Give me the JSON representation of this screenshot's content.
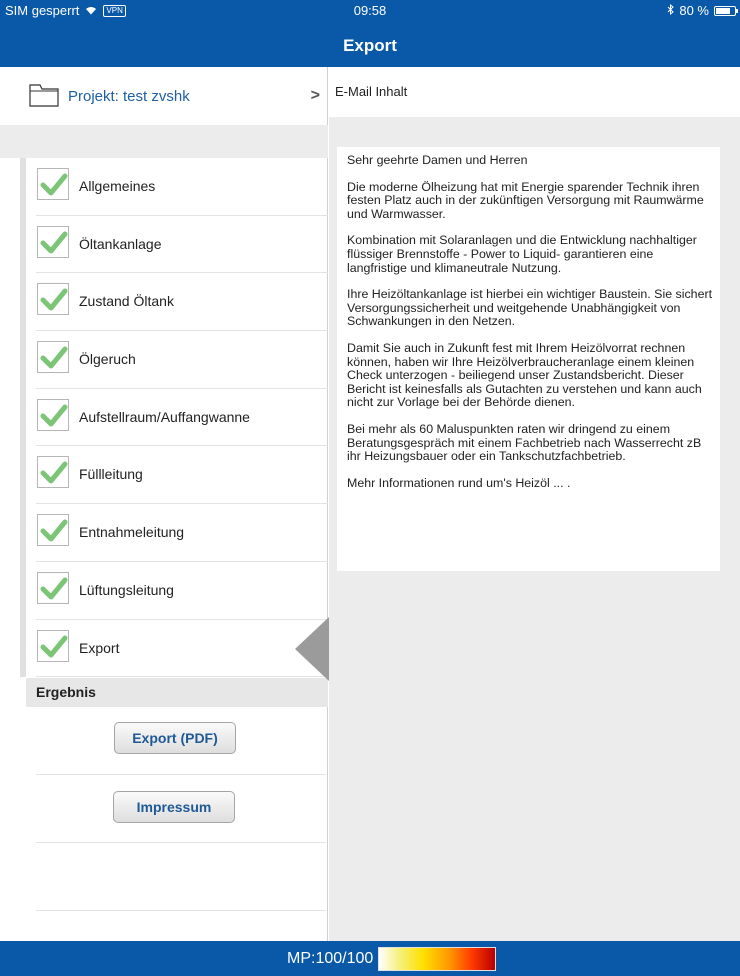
{
  "status_bar": {
    "carrier": "SIM gesperrt",
    "vpn": "VPN",
    "time": "09:58",
    "battery": "80 %"
  },
  "nav": {
    "title": "Export"
  },
  "project": {
    "label": "Projekt: test zvshk",
    "chevron": ">"
  },
  "sections": [
    {
      "label": "Allgemeines",
      "checked": true
    },
    {
      "label": "Öltankanlage",
      "checked": true
    },
    {
      "label": "Zustand Öltank",
      "checked": true
    },
    {
      "label": "Ölgeruch",
      "checked": true
    },
    {
      "label": "Aufstellraum/Auffangwanne",
      "checked": true
    },
    {
      "label": "Füllleitung",
      "checked": true
    },
    {
      "label": "Entnahmeleitung",
      "checked": true
    },
    {
      "label": "Lüftungsleitung",
      "checked": true
    },
    {
      "label": "Export",
      "checked": true
    }
  ],
  "ergebnis": {
    "title": "Ergebnis",
    "export_button": "Export (PDF)",
    "impressum_button": "Impressum"
  },
  "email": {
    "header": "E-Mail Inhalt",
    "paragraphs": [
      "Sehr geehrte Damen und Herren",
      "Die moderne Ölheizung hat mit Energie sparender Technik ihren festen Platz auch in der zukünftigen Versorgung mit Raumwärme und Warmwasser.",
      "Kombination mit Solaranlagen und die Entwicklung nachhaltiger flüssiger Brennstoffe - Power to Liquid- garantieren eine langfristige und klimaneutrale Nutzung.",
      "Ihre Heizöltankanlage ist hierbei ein wichtiger Baustein. Sie sichert Versorgungssicherheit und weitgehende Unabhängigkeit von Schwankungen in den Netzen.",
      "Damit Sie auch in Zukunft fest mit Ihrem Heizölvorrat rechnen können, haben wir Ihre Heizölverbraucheranlage einem kleinen Check unterzogen - beiliegend unser Zustandsbericht. Dieser Bericht ist keinesfalls als Gutachten zu verstehen und kann auch nicht zur Vorlage bei der Behörde dienen.",
      "Bei mehr als 60 Maluspunkten raten wir dringend zu einem Beratungsgespräch mit einem Fachbetrieb nach Wasserrecht zB ihr Heizungsbauer oder ein Tankschutzfachbetrieb.",
      "Mehr Informationen rund um's Heizöl ... ."
    ]
  },
  "footer": {
    "mp_label": "MP:100/100"
  },
  "colors": {
    "brand": "#0a59a8",
    "check": "#7cc576",
    "link": "#1e5fa5"
  }
}
